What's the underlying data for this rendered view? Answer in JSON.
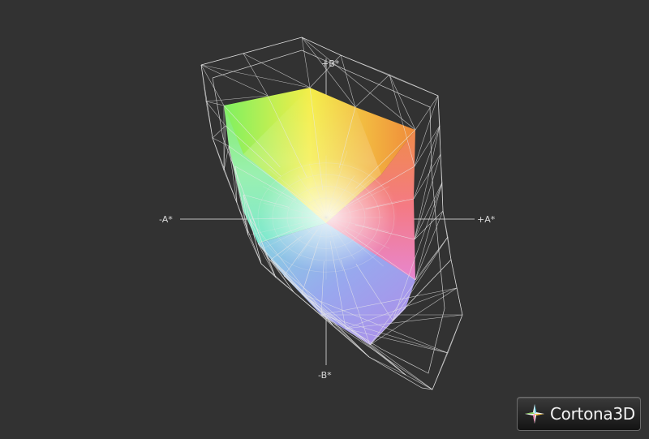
{
  "viewer": {
    "background": "#323232",
    "logo_text": "Cortona3D"
  },
  "axes": {
    "plus_b": "+B*",
    "minus_b": "-B*",
    "plus_a": "+A*",
    "minus_a": "-A*"
  },
  "colors": {
    "axis_line": "#bfbfbf",
    "wireframe": "#e6e6e6",
    "gamut_green": "#86e85a",
    "gamut_yellow": "#f2e83a",
    "gamut_orange": "#f0903a",
    "gamut_red": "#f06a6a",
    "gamut_magenta": "#e58ae8",
    "gamut_purple": "#a88af0",
    "gamut_blue": "#7aa8e8",
    "gamut_cyan": "#7ae8c8"
  }
}
